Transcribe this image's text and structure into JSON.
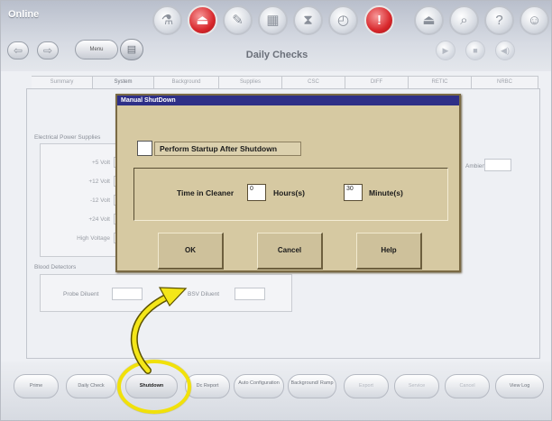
{
  "header": {
    "status": "Online",
    "menu_label": "Menu",
    "page_title": "Daily Checks",
    "back_glyph": "⇦",
    "forward_glyph": "⇨",
    "monitor_glyph": "▤",
    "tool_icons": [
      {
        "name": "chemistry-icon",
        "glyph": "⚗"
      },
      {
        "name": "exit-icon",
        "glyph": "⏏"
      },
      {
        "name": "reagents-icon",
        "glyph": "✎"
      },
      {
        "name": "report-icon",
        "glyph": "▦"
      },
      {
        "name": "hourglass-icon",
        "glyph": "⧗"
      },
      {
        "name": "gauge-icon",
        "glyph": "◴"
      },
      {
        "name": "alert-icon",
        "glyph": "!"
      },
      {
        "name": "eject-icon",
        "glyph": "⏏"
      },
      {
        "name": "search-icon",
        "glyph": "⌕"
      },
      {
        "name": "help-icon",
        "glyph": "?"
      },
      {
        "name": "user-icon",
        "glyph": "☺"
      }
    ],
    "faded_controls": [
      {
        "name": "play-icon",
        "glyph": "▶"
      },
      {
        "name": "stop-icon",
        "glyph": "■"
      },
      {
        "name": "volume-icon",
        "glyph": "◀)"
      }
    ]
  },
  "tabs": [
    "Summary",
    "System",
    "Background",
    "Supplies",
    "CSC",
    "DIFF",
    "RETIC",
    "NRBC"
  ],
  "active_tab": "System",
  "system": {
    "electrical_title": "Electrical Power Supplies",
    "rows": [
      "+5 Volt",
      "+12 Volt",
      "-12 Volt",
      "+24 Volt",
      "High Voltage"
    ],
    "blood_title": "Blood Detectors",
    "probe_label": "Probe Diluent",
    "bsv_label": "BSV Diluent",
    "ambient_label": "Ambient"
  },
  "modal": {
    "title": "Manual ShutDown",
    "checkbox_label": "Perform Startup After Shutdown",
    "time_label": "Time in Cleaner",
    "hours_value": "0",
    "hours_label": "Hours(s)",
    "minutes_value": "30",
    "minutes_label": "Minute(s)",
    "ok_label": "OK",
    "cancel_label": "Cancel",
    "help_label": "Help"
  },
  "bottom_bar": {
    "buttons": [
      "Prime",
      "Daily Check",
      "Shutdown",
      "Dc Report",
      "Auto Configuration",
      "Background/ Ramp",
      "Export",
      "Service",
      "Cancel",
      "View Log"
    ]
  },
  "colors": {
    "modal_bg": "#d6c9a2",
    "modal_title_bg": "#2e2f87",
    "highlight": "#f1e10a",
    "alert_red": "#d8282c"
  }
}
